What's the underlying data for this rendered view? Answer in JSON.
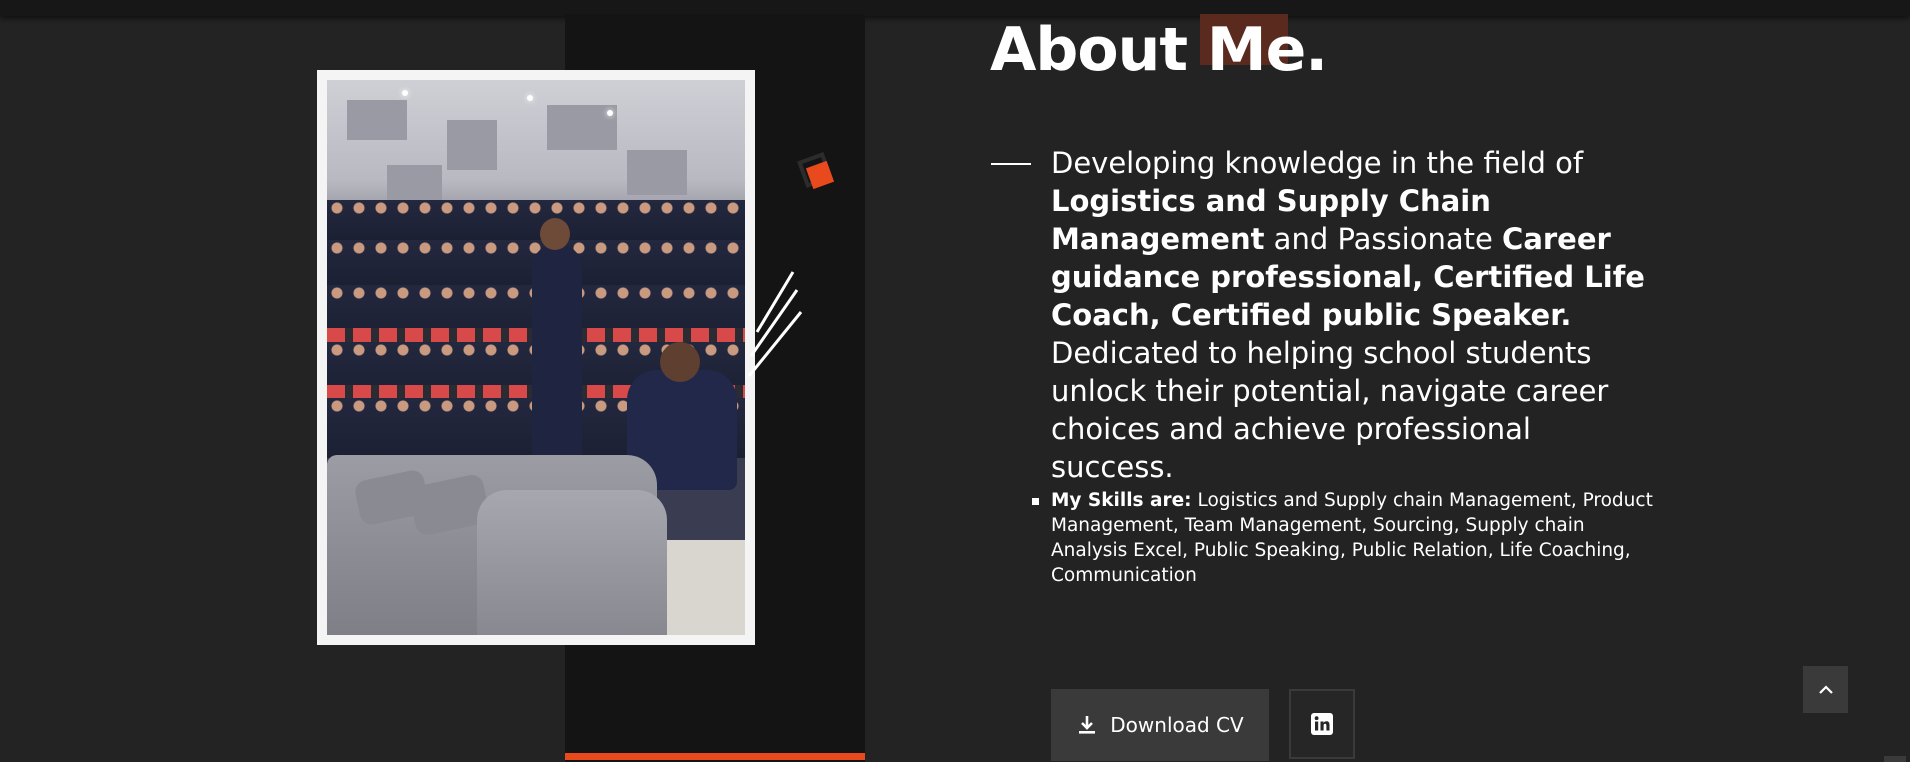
{
  "about": {
    "title": "About Me.",
    "intro": {
      "lead": "Developing knowledge in the field of ",
      "field": "Logistics and Supply Chain Management",
      "mid": " and Passionate ",
      "roles": "Career guidance professional, Certified Life Coach, Certified public Speaker.",
      "tail": " Dedicated to helping school students unlock their potential, navigate career choices and achieve professional success."
    },
    "skills": {
      "label": "My Skills are:",
      "text": " Logistics and Supply chain Management, Product Management, Team Management, Sourcing, Supply chain Analysis Excel, Public Speaking, Public Relation, Life Coaching, Communication"
    }
  },
  "actions": {
    "download_cv_label": "Download CV",
    "download_icon": "download-icon",
    "linkedin_icon": "linkedin-icon",
    "scroll_top_icon": "chevron-up-icon"
  },
  "colors": {
    "background": "#232323",
    "panel": "#141414",
    "accent": "#e8491d",
    "button": "#3a3a3a"
  }
}
